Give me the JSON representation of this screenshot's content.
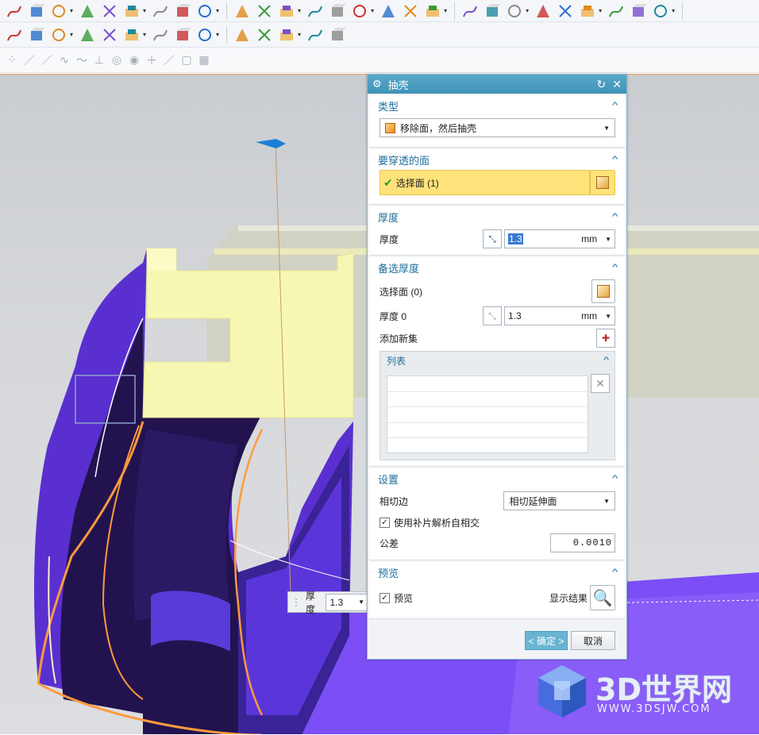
{
  "toolbar_icons": {
    "row1": [
      "curve-icon",
      "helix-icon",
      "law-curve-icon",
      "point-set-icon",
      "text-curve-icon",
      "pen-icon",
      "magic-wand-icon",
      "text-a-icon",
      "fillet-curve-icon",
      "d-shape-icon",
      "offset-curve-icon",
      "project-curve-icon",
      "extrude-face-icon",
      "intersect-curve-icon",
      "layer-icon",
      "datum-icon",
      "move-icon",
      "edit-icon",
      "play-icon",
      "grid-icon",
      "measure-icon",
      "surface-1-icon",
      "surface-2-icon",
      "surface-3-icon",
      "surface-4-icon",
      "surface-5-icon",
      "surface-6-icon"
    ],
    "row2": [
      "block-icon",
      "sweep-icon",
      "shell-icon",
      "pyramid-icon",
      "trim-body-icon",
      "boolean-unite-icon",
      "boolean-subtract-icon",
      "boolean-intersect-icon",
      "split-body-icon",
      "offset-face-icon",
      "scale-icon",
      "mirror-icon",
      "pattern-icon",
      "thicken-icon"
    ],
    "row3": [
      "point-snap-icon",
      "line-icon",
      "line-2-icon",
      "spline-icon",
      "wave-icon",
      "tangent-icon",
      "circle-icon",
      "center-icon",
      "plus-icon",
      "slash-icon",
      "cube-small-icon",
      "grid-small-icon"
    ]
  },
  "float_thickness": {
    "label": "厚度",
    "value": "1.3"
  },
  "dialog": {
    "title": "抽壳",
    "type_section": {
      "title": "类型",
      "selected": "移除面，然后抽壳"
    },
    "faces_section": {
      "title": "要穿透的面",
      "select_label": "选择面 (1)"
    },
    "thickness_section": {
      "title": "厚度",
      "label": "厚度",
      "value": "1.3",
      "unit": "mm"
    },
    "alt_section": {
      "title": "备选厚度",
      "select_label": "选择面 (0)",
      "thickness_label": "厚度 0",
      "value": "1.3",
      "unit": "mm",
      "add_set": "添加新集",
      "list_title": "列表"
    },
    "settings": {
      "title": "设置",
      "tangent_label": "相切边",
      "tangent_value": "相切延伸面",
      "patch_label": "使用补片解析自相交",
      "tolerance_label": "公差",
      "tolerance_value": "0.0010"
    },
    "preview": {
      "title": "预览",
      "preview_label": "预览",
      "show_result": "显示结果"
    },
    "ok": "< 确定 >",
    "cancel": "取消"
  },
  "watermark": {
    "brand": "3D世界网",
    "url": "WWW.3DSJW.COM"
  },
  "colors": {
    "accent": "#3f92b8",
    "part_purple": "#5a2fd0",
    "part_dark": "#22134f",
    "yellow_face": "#f7f7b4"
  }
}
